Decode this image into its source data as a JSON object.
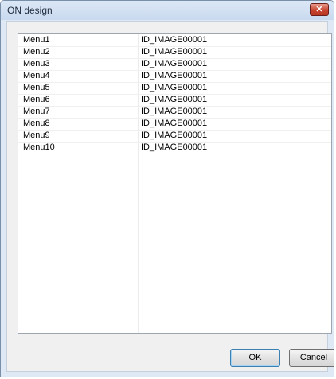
{
  "window": {
    "title": "ON design",
    "close_label": "✕"
  },
  "list": {
    "rows": [
      {
        "name": "Menu1",
        "id": "ID_IMAGE00001"
      },
      {
        "name": "Menu2",
        "id": "ID_IMAGE00001"
      },
      {
        "name": "Menu3",
        "id": "ID_IMAGE00001"
      },
      {
        "name": "Menu4",
        "id": "ID_IMAGE00001"
      },
      {
        "name": "Menu5",
        "id": "ID_IMAGE00001"
      },
      {
        "name": "Menu6",
        "id": "ID_IMAGE00001"
      },
      {
        "name": "Menu7",
        "id": "ID_IMAGE00001"
      },
      {
        "name": "Menu8",
        "id": "ID_IMAGE00001"
      },
      {
        "name": "Menu9",
        "id": "ID_IMAGE00001"
      },
      {
        "name": "Menu10",
        "id": "ID_IMAGE00001"
      }
    ]
  },
  "buttons": {
    "ok": "OK",
    "cancel": "Cancel"
  }
}
